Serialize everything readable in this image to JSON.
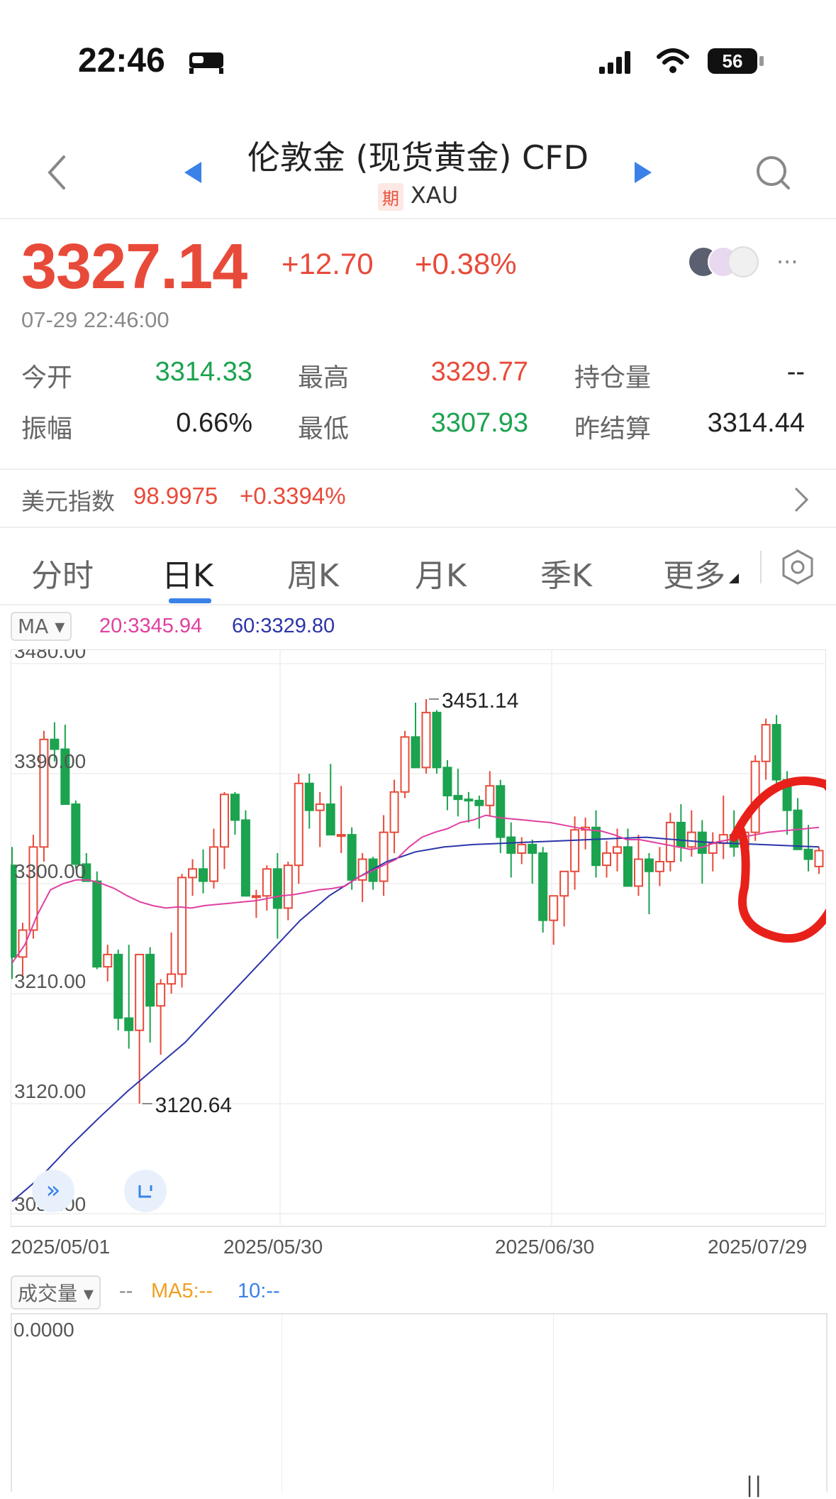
{
  "status_bar": {
    "time": "22:46",
    "battery": "56"
  },
  "header": {
    "title": "伦敦金 (现货黄金) CFD",
    "tag": "期",
    "symbol": "XAU"
  },
  "quote": {
    "price": "3327.14",
    "change": "+12.70",
    "change_pct": "+0.38%",
    "timestamp": "07-29 22:46:00"
  },
  "stats": {
    "open_label": "今开",
    "open": "3314.33",
    "high_label": "最高",
    "high": "3329.77",
    "oi_label": "持仓量",
    "oi": "--",
    "amp_label": "振幅",
    "amp": "0.66%",
    "low_label": "最低",
    "low": "3307.93",
    "settle_label": "昨结算",
    "settle": "3314.44"
  },
  "dxy": {
    "label": "美元指数",
    "value": "98.9975",
    "change": "+0.3394%"
  },
  "tabs": [
    "分时",
    "日K",
    "周K",
    "月K",
    "季K",
    "更多"
  ],
  "active_tab": 1,
  "chart_legend": {
    "ma_chip": "MA",
    "ma20": "20:3345.94",
    "ma60": "60:3329.80"
  },
  "volume_legend": {
    "chip": "成交量",
    "dash": "--",
    "ma5": "MA5:--",
    "ma10": "10:--",
    "axis": "0.0000"
  },
  "colors": {
    "up": "#e84a3a",
    "down": "#1ba34f",
    "ma20": "#e040a0",
    "ma60": "#2c35a8",
    "accent": "#3a82e8"
  },
  "chart_data": {
    "type": "candlestick",
    "title": "",
    "y_ticks": [
      "3480.00",
      "3390.00",
      "3300.00",
      "3210.00",
      "3120.00",
      "3030.00"
    ],
    "ylim": [
      3030,
      3480
    ],
    "x_ticks": [
      "2025/05/01",
      "2025/05/30",
      "2025/06/30",
      "2025/07/29"
    ],
    "annotations": {
      "max": "3451.14",
      "min": "3120.64"
    },
    "series": [
      {
        "name": "ohlc",
        "values": [
          [
            3315,
            3330,
            3222,
            3240
          ],
          [
            3240,
            3268,
            3225,
            3262
          ],
          [
            3262,
            3340,
            3255,
            3330
          ],
          [
            3330,
            3425,
            3318,
            3418
          ],
          [
            3418,
            3432,
            3400,
            3410
          ],
          [
            3410,
            3430,
            3365,
            3365
          ],
          [
            3365,
            3368,
            3312,
            3316
          ],
          [
            3316,
            3325,
            3305,
            3302
          ],
          [
            3302,
            3310,
            3230,
            3232
          ],
          [
            3232,
            3250,
            3220,
            3242
          ],
          [
            3242,
            3246,
            3180,
            3190
          ],
          [
            3190,
            3250,
            3165,
            3180
          ],
          [
            3180,
            3240,
            3120,
            3242
          ],
          [
            3242,
            3248,
            3170,
            3200
          ],
          [
            3200,
            3222,
            3160,
            3218
          ],
          [
            3218,
            3260,
            3210,
            3226
          ],
          [
            3226,
            3308,
            3215,
            3305
          ],
          [
            3305,
            3320,
            3290,
            3312
          ],
          [
            3312,
            3328,
            3292,
            3302
          ],
          [
            3302,
            3345,
            3296,
            3330
          ],
          [
            3330,
            3375,
            3312,
            3373
          ],
          [
            3373,
            3375,
            3340,
            3352
          ],
          [
            3352,
            3360,
            3290,
            3290
          ],
          [
            3290,
            3295,
            3272,
            3290
          ],
          [
            3290,
            3315,
            3278,
            3312
          ],
          [
            3312,
            3325,
            3255,
            3280
          ],
          [
            3280,
            3318,
            3270,
            3315
          ],
          [
            3315,
            3390,
            3300,
            3382
          ],
          [
            3382,
            3390,
            3345,
            3360
          ],
          [
            3360,
            3375,
            3330,
            3365
          ],
          [
            3365,
            3398,
            3345,
            3340
          ],
          [
            3340,
            3380,
            3325,
            3340
          ],
          [
            3340,
            3346,
            3295,
            3303
          ],
          [
            3303,
            3325,
            3285,
            3320
          ],
          [
            3320,
            3322,
            3295,
            3302
          ],
          [
            3302,
            3356,
            3290,
            3342
          ],
          [
            3342,
            3385,
            3325,
            3375
          ],
          [
            3375,
            3425,
            3370,
            3420
          ],
          [
            3420,
            3448,
            3395,
            3395
          ],
          [
            3395,
            3451,
            3390,
            3440
          ],
          [
            3440,
            3442,
            3390,
            3395
          ],
          [
            3395,
            3401,
            3360,
            3372
          ],
          [
            3372,
            3394,
            3355,
            3369
          ],
          [
            3369,
            3375,
            3350,
            3368
          ],
          [
            3368,
            3372,
            3345,
            3364
          ],
          [
            3364,
            3392,
            3355,
            3380
          ],
          [
            3380,
            3385,
            3325,
            3338
          ],
          [
            3338,
            3350,
            3305,
            3325
          ],
          [
            3325,
            3338,
            3316,
            3332
          ],
          [
            3332,
            3336,
            3300,
            3325
          ],
          [
            3325,
            3330,
            3260,
            3270
          ],
          [
            3270,
            3290,
            3250,
            3290
          ],
          [
            3290,
            3310,
            3265,
            3310
          ],
          [
            3310,
            3355,
            3295,
            3344
          ],
          [
            3344,
            3354,
            3328,
            3346
          ],
          [
            3346,
            3360,
            3305,
            3315
          ],
          [
            3315,
            3335,
            3305,
            3325
          ],
          [
            3325,
            3345,
            3310,
            3330
          ],
          [
            3330,
            3345,
            3298,
            3298
          ],
          [
            3298,
            3340,
            3290,
            3320
          ],
          [
            3320,
            3325,
            3275,
            3310
          ],
          [
            3310,
            3330,
            3298,
            3318
          ],
          [
            3318,
            3358,
            3310,
            3350
          ],
          [
            3350,
            3365,
            3318,
            3330
          ],
          [
            3330,
            3360,
            3322,
            3342
          ],
          [
            3342,
            3352,
            3300,
            3325
          ],
          [
            3325,
            3342,
            3310,
            3333
          ],
          [
            3333,
            3372,
            3320,
            3340
          ],
          [
            3340,
            3360,
            3322,
            3330
          ],
          [
            3330,
            3342,
            3300,
            3342
          ],
          [
            3342,
            3405,
            3335,
            3400
          ],
          [
            3400,
            3435,
            3385,
            3430
          ],
          [
            3430,
            3438,
            3375,
            3385
          ],
          [
            3385,
            3392,
            3340,
            3360
          ],
          [
            3360,
            3370,
            3330,
            3328
          ],
          [
            3328,
            3348,
            3310,
            3320
          ],
          [
            3314,
            3330,
            3308,
            3327
          ]
        ]
      },
      {
        "name": "20",
        "values": [
          3235,
          3250,
          3275,
          3295,
          3300,
          3303,
          3303,
          3300,
          3296,
          3290,
          3285,
          3282,
          3280,
          3281,
          3280,
          3282,
          3283,
          3284,
          3285,
          3286,
          3288,
          3290,
          3291,
          3293,
          3295,
          3296,
          3298,
          3305,
          3310,
          3315,
          3320,
          3330,
          3338,
          3342,
          3345,
          3350,
          3352,
          3356,
          3354,
          3353,
          3352,
          3351,
          3350,
          3348,
          3346,
          3344,
          3343,
          3340,
          3336,
          3336,
          3334,
          3332,
          3330,
          3328,
          3330,
          3334,
          3336,
          3338,
          3340,
          3342,
          3343,
          3344,
          3345,
          3346
        ]
      },
      {
        "name": "60",
        "values": [
          3040,
          3060,
          3085,
          3108,
          3130,
          3150,
          3170,
          3195,
          3220,
          3245,
          3270,
          3290,
          3305,
          3318,
          3326,
          3330,
          3332,
          3333,
          3334,
          3335,
          3336,
          3337,
          3338,
          3336,
          3334,
          3333,
          3332,
          3331,
          3330
        ]
      }
    ]
  }
}
